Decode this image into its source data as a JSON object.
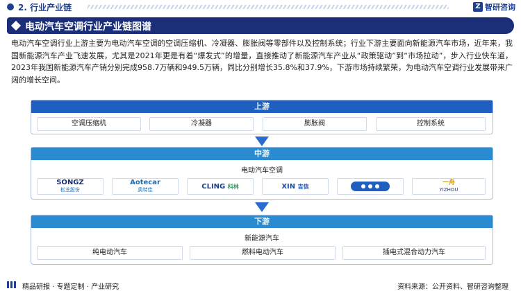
{
  "header": {
    "section_title": "2. 行业产业链",
    "brand_name": "智研咨询"
  },
  "banner": {
    "title": "电动汽车空调行业产业链图谱"
  },
  "intro": "电动汽车空调行业上游主要为电动汽车空调的空调压缩机、冷凝器、膨胀阀等零部件以及控制系统；行业下游主要面向新能源汽车市场，近年来，我国新能源汽车产业飞速发展，尤其是2021年更是有着“爆发式”的增量，直接推动了新能源汽车产业从“政策驱动”到“市场拉动”，步入行业快车道，2023年我国新能源汽车产销分别完成958.7万辆和949.5万辆，同比分别增长35.8%和37.9%，下游市场持续繁荣，为电动汽车空调行业发展带来广阔的增长空间。",
  "upstream": {
    "title": "上游",
    "items": [
      "空调压缩机",
      "冷凝器",
      "膨胀阀",
      "控制系统"
    ]
  },
  "midstream": {
    "title": "中游",
    "subtitle": "电动汽车空调",
    "logos": [
      {
        "text": "SONGZ",
        "sub": "松芝股份",
        "color": "#1a2f78"
      },
      {
        "text": "Aotecar",
        "sub": "奥特佳",
        "color": "#1a6fb8"
      },
      {
        "text": "CLING",
        "sub": "科林",
        "color": "#1a3f8f"
      },
      {
        "text": "XIN",
        "sub": "吉信",
        "color": "#1a4fa8"
      },
      {
        "text": "",
        "sub": "",
        "color": "#1f5fbf"
      },
      {
        "text": "YIZHOU",
        "sub": "一舟",
        "color": "#c89a1a"
      }
    ]
  },
  "downstream": {
    "title": "下游",
    "subtitle": "新能源汽车",
    "items": [
      "纯电动汽车",
      "燃料电动汽车",
      "插电式混合动力汽车"
    ]
  },
  "footer": {
    "left": "精品研报 · 专题定制 · 产业研究",
    "right": "资料来源：公开资料、智研咨询整理"
  },
  "colors": {
    "primary": "#1a2f78",
    "accent": "#1f5fbf",
    "border": "#a9bde2"
  }
}
